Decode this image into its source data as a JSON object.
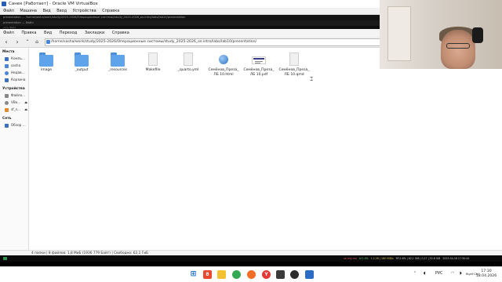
{
  "vbox": {
    "title": "Санек [Работает] - Oracle VM VirtualBox",
    "menu": [
      "Файл",
      "Машина",
      "Вид",
      "Ввод",
      "Устройства",
      "Справка"
    ]
  },
  "guest_bars": {
    "bar1": "presentation — /home/sasha/work/study/2025-2026/Операционные системы/study_2025-2026_os-intro/labs/lab10/presentation",
    "bar2": "presentation — Файл",
    "bar3": "сеть  Файл"
  },
  "fm": {
    "menu": [
      "Файл",
      "Правка",
      "Вид",
      "Переход",
      "Закладки",
      "Справка"
    ],
    "path": "/home/sasha/work/study/2025-2026/Операционные системы/study_2025-2026_os-intro/labs/lab10/presentation/",
    "sidebar": {
      "places_heading": "Места",
      "places": [
        {
          "label": "Компь...",
          "icon": "computer-icon",
          "color": "#3b6fc2"
        },
        {
          "label": "sasha",
          "icon": "home-icon",
          "color": "#4a86d8"
        },
        {
          "label": "Недав...",
          "icon": "recent-icon",
          "color": "#4a86d8"
        },
        {
          "label": "Корзина",
          "icon": "trash-icon",
          "color": "#3b6fc2"
        }
      ],
      "devices_heading": "Устройства",
      "devices": [
        {
          "label": "Файло...",
          "icon": "filesystem-icon",
          "color": "#888888"
        },
        {
          "label": "VBo...",
          "icon": "disc-icon",
          "color": "#888888"
        },
        {
          "label": "sf_s...",
          "icon": "shared-folder-icon",
          "color": "#e38a2c"
        }
      ],
      "network_heading": "Сеть",
      "network": [
        {
          "label": "Обзор ...",
          "icon": "network-icon",
          "color": "#3b6fc2"
        }
      ]
    },
    "files": [
      {
        "name": "image",
        "kind": "folder"
      },
      {
        "name": "_output",
        "kind": "folder"
      },
      {
        "name": "_resources",
        "kind": "folder"
      },
      {
        "name": "Makefile",
        "kind": "doc"
      },
      {
        "name": "_quarto.yml",
        "kind": "doc"
      },
      {
        "name": "Семёнов_Преза_ЛБ 10.html",
        "kind": "html"
      },
      {
        "name": "Семёнов_Преза_ЛБ 10.pdf",
        "kind": "pdf"
      },
      {
        "name": "Семёнов_Преза_ЛБ 10.qmd",
        "kind": "doc"
      }
    ],
    "status": "4 папки | 8 файлов: 1,8 МиБ (1936 779 Байт) | Свободно: 62,1 ГиБ"
  },
  "panel": {
    "segments": [
      "sa mly-ma",
      "ld 1.0%",
      "1.2 26 | 180 MiB/s",
      "RF:2.6% | 62,1 GiB | 0,17 | 52.6 GiB",
      "2025-04-18 17:30:44"
    ]
  },
  "taskbar": {
    "tray_lang": "РУС",
    "time": "17:30",
    "date": "18.04.2026",
    "weather": "Right Ctrl"
  }
}
